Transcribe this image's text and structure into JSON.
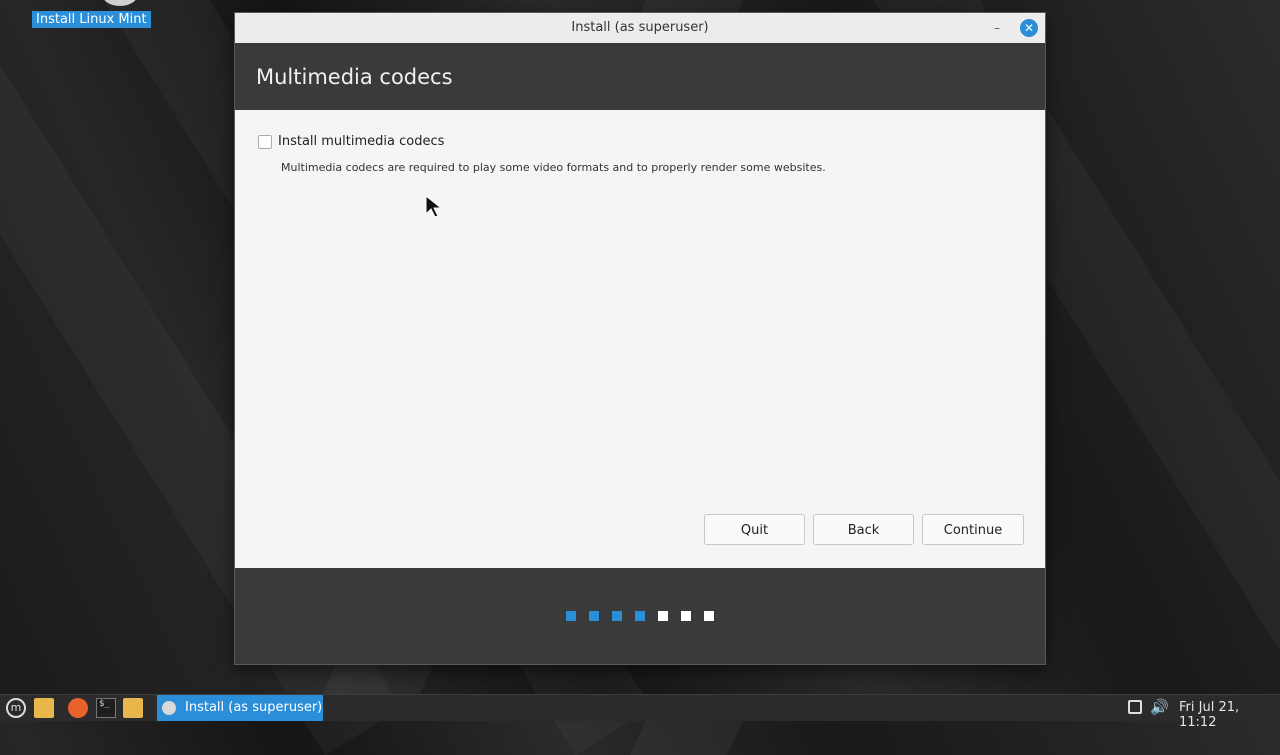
{
  "desktop": {
    "icon_label": "Install Linux Mint"
  },
  "window": {
    "title": "Install (as superuser)",
    "heading": "Multimedia codecs",
    "checkbox_label": "Install multimedia codecs",
    "checkbox_checked": false,
    "description": "Multimedia codecs are required to play some video formats and to properly render some websites.",
    "buttons": {
      "quit": "Quit",
      "back": "Back",
      "continue": "Continue"
    },
    "progress": {
      "steps_total": 7,
      "steps_completed": 4
    },
    "accent_color": "#2a8fd8"
  },
  "taskbar": {
    "task_label": "Install (as superuser)",
    "clock": "Fri Jul 21, 11:12",
    "icons": [
      "mint-menu-icon",
      "files-icon",
      "firefox-icon",
      "terminal-icon",
      "folder-icon",
      "display-icon",
      "volume-icon"
    ]
  }
}
